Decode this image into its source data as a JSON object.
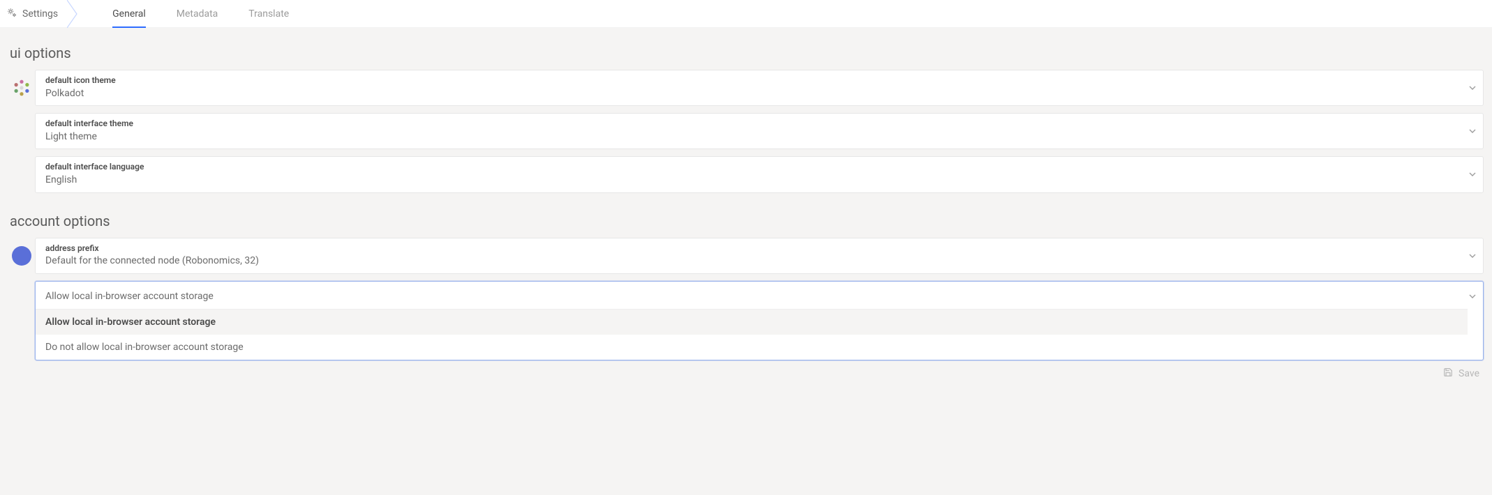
{
  "breadcrumb": {
    "label": "Settings"
  },
  "tabs": [
    {
      "id": "general",
      "label": "General",
      "active": true
    },
    {
      "id": "metadata",
      "label": "Metadata",
      "active": false
    },
    {
      "id": "translate",
      "label": "Translate",
      "active": false
    }
  ],
  "sections": {
    "ui": {
      "title": "ui options",
      "icon_theme": {
        "label": "default icon theme",
        "value": "Polkadot"
      },
      "iface_theme": {
        "label": "default interface theme",
        "value": "Light theme"
      },
      "iface_lang": {
        "label": "default interface language",
        "value": "English"
      }
    },
    "account": {
      "title": "account options",
      "address_prefix": {
        "label": "address prefix",
        "value": "Default for the connected node (Robonomics, 32)"
      },
      "storage": {
        "value": "Allow local in-browser account storage",
        "options": [
          {
            "label": "Allow local in-browser account storage",
            "selected": true
          },
          {
            "label": "Do not allow local in-browser account storage",
            "selected": false
          }
        ]
      }
    }
  },
  "footer": {
    "save_label": "Save"
  },
  "colors": {
    "accent": "#2e6cff",
    "page_bg": "#f5f4f3",
    "text_muted": "#9c9c9c"
  }
}
